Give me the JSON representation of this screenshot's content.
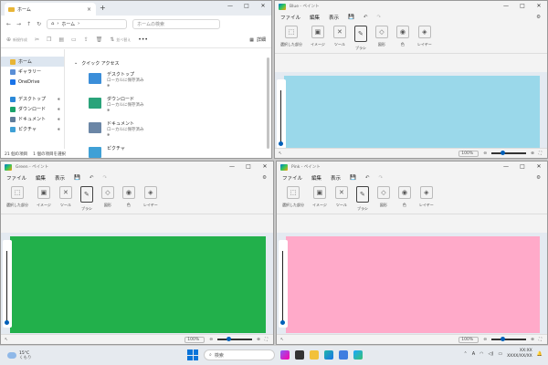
{
  "explorer": {
    "tab_title": "ホーム",
    "new_tab": "+",
    "address_crumb": "ホーム",
    "search_placeholder": "ホームの検索",
    "new_label": "新規作成",
    "sort_label": "並べ替え",
    "more": "•••",
    "details_label": "詳細",
    "sidebar": [
      {
        "label": "ホーム",
        "color": "#e8b536",
        "active": true
      },
      {
        "label": "ギャラリー",
        "color": "#5b8fd6"
      },
      {
        "label": "OneDrive",
        "color": "#1a73e8"
      },
      {
        "label": "デスクトップ",
        "color": "#2b88d8"
      },
      {
        "label": "ダウンロード",
        "color": "#1aa36a"
      },
      {
        "label": "ドキュメント",
        "color": "#607d9b"
      },
      {
        "label": "ピクチャ",
        "color": "#3fa0d6"
      }
    ],
    "quick_access_label": "クイック アクセス",
    "quick_access": [
      {
        "name": "デスクトップ",
        "sub": "ローカルに保存済み",
        "color": "#3b8ed9"
      },
      {
        "name": "ダウンロード",
        "sub": "ローカルに保存済み",
        "color": "#2aa37a"
      },
      {
        "name": "ドキュメント",
        "sub": "ローカルに保存済み",
        "color": "#6b86a6"
      },
      {
        "name": "ピクチャ",
        "sub": "",
        "color": "#3fa0d6"
      }
    ],
    "status_count": "21 個の項目",
    "status_selected": "1 個の項目を選択"
  },
  "paints": {
    "blue": {
      "title": "Blue - ペイント",
      "canvas_color": "#9ad8ea",
      "zoom": "100%"
    },
    "green": {
      "title": "Green - ペイント",
      "canvas_color": "#22b04b",
      "zoom": "100%"
    },
    "pink": {
      "title": "Pink - ペイント",
      "canvas_color": "#ffaac9",
      "zoom": "100%"
    }
  },
  "paint_menu": {
    "file": "ファイル",
    "edit": "編集",
    "view": "表示"
  },
  "ribbon": [
    "選択した部分",
    "イメージ",
    "ツール",
    "ブラシ",
    "図形",
    "色",
    "レイヤー"
  ],
  "taskbar": {
    "temp": "15°C",
    "weather": "くもり",
    "search": "検索",
    "time": "XX:XX",
    "date": "XXXX/XX/XX",
    "ime": "A"
  },
  "colors": {
    "accent": "#005fb8",
    "taskbar": "#e6eaef"
  }
}
